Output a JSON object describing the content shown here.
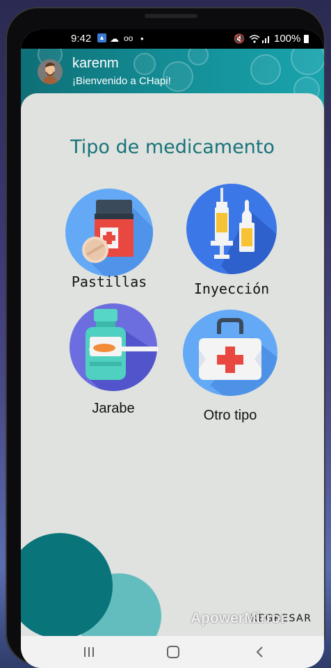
{
  "status_bar": {
    "time": "9:42",
    "battery": "100%",
    "icons": [
      "app-icon",
      "cloud-icon",
      "voicemail-icon",
      "dot-icon",
      "mute-icon",
      "wifi-icon",
      "signal-icon",
      "battery-icon"
    ]
  },
  "header": {
    "username": "karenm",
    "welcome": "¡Bienvenido a CHapi!",
    "avatar_icon": "user-avatar-icon"
  },
  "main": {
    "title": "Tipo de medicamento",
    "options": [
      {
        "label": "Pastillas",
        "icon": "pill-bottle-icon"
      },
      {
        "label": "Inyección",
        "icon": "syringe-vial-icon"
      },
      {
        "label": "Jarabe",
        "icon": "syrup-spoon-icon"
      },
      {
        "label": "Otro tipo",
        "icon": "first-aid-kit-icon"
      }
    ],
    "back_label": "REGRESAR"
  },
  "watermark": "ApowerMirror",
  "navigation_bar": {
    "icons": [
      "recent-apps-icon",
      "home-icon",
      "back-icon"
    ]
  },
  "colors": {
    "teal_dark": "#0a747b",
    "teal": "#138b93",
    "teal_light": "#63bdbf",
    "title_teal": "#187379",
    "card_bg": "#dfe2df",
    "icon_blue_light": "#64a9f6",
    "icon_blue_dark": "#2f70e0"
  }
}
